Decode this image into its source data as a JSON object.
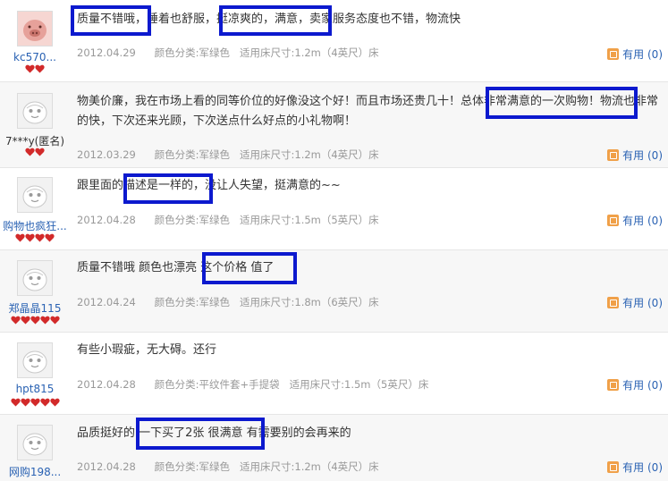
{
  "reviews": [
    {
      "user": "kc570...",
      "hearts": 2,
      "avatar": "pig-avatar",
      "text": "质量不错哦，睡着也舒服，挺凉爽的，满意，卖家服务态度也不错，物流快",
      "date": "2012.04.29",
      "color_label": "颜色分类:",
      "color": "军绿色",
      "size_label": "适用床尺寸:",
      "size": "1.2m（4英尺）床",
      "useful_label": "有用",
      "useful_count": "(0)"
    },
    {
      "user": "7***y(匿名)",
      "hearts": 2,
      "avatar": "default-avatar",
      "text": "物美价廉，我在市场上看的同等价位的好像没这个好！而且市场还贵几十！总体非常满意的一次购物！物流也非常的快，下次还来光顾，下次送点什么好点的小礼物啊！",
      "date": "2012.03.29",
      "color_label": "颜色分类:",
      "color": "军绿色",
      "size_label": "适用床尺寸:",
      "size": "1.2m（4英尺）床",
      "useful_label": "有用",
      "useful_count": "(0)"
    },
    {
      "user": "购物也疯狂...",
      "hearts": 4,
      "avatar": "default-avatar",
      "text": "跟里面的描述是一样的，没让人失望，挺满意的~~",
      "date": "2012.04.28",
      "color_label": "颜色分类:",
      "color": "军绿色",
      "size_label": "适用床尺寸:",
      "size": "1.5m（5英尺）床",
      "useful_label": "有用",
      "useful_count": "(0)"
    },
    {
      "user": "郑晶晶115",
      "hearts": 5,
      "avatar": "default-avatar",
      "text": "质量不错哦 颜色也漂亮 这个价格 值了",
      "date": "2012.04.24",
      "color_label": "颜色分类:",
      "color": "军绿色",
      "size_label": "适用床尺寸:",
      "size": "1.8m（6英尺）床",
      "useful_label": "有用",
      "useful_count": "(0)"
    },
    {
      "user": "hpt815",
      "hearts": 5,
      "avatar": "default-avatar",
      "text": "有些小瑕疵，无大碍。还行",
      "date": "2012.04.28",
      "color_label": "颜色分类:",
      "color": "平纹件套+手提袋",
      "size_label": "适用床尺寸:",
      "size": "1.5m（5英尺）床",
      "useful_label": "有用",
      "useful_count": "(0)"
    },
    {
      "user": "网购198...",
      "hearts": 0,
      "avatar": "default-avatar",
      "text": "品质挺好的 一下买了2张 很满意 有需要别的会再来的",
      "date": "2012.04.28",
      "color_label": "颜色分类:",
      "color": "军绿色",
      "size_label": "适用床尺寸:",
      "size": "1.2m（4英尺）床",
      "useful_label": "有用",
      "useful_count": "(0)"
    }
  ],
  "colors": {
    "highlight": "#0c19ce",
    "username": "#2a62b3",
    "meta": "#999999",
    "heart": "#d22a2a",
    "useful_icon": "#f0a048"
  }
}
